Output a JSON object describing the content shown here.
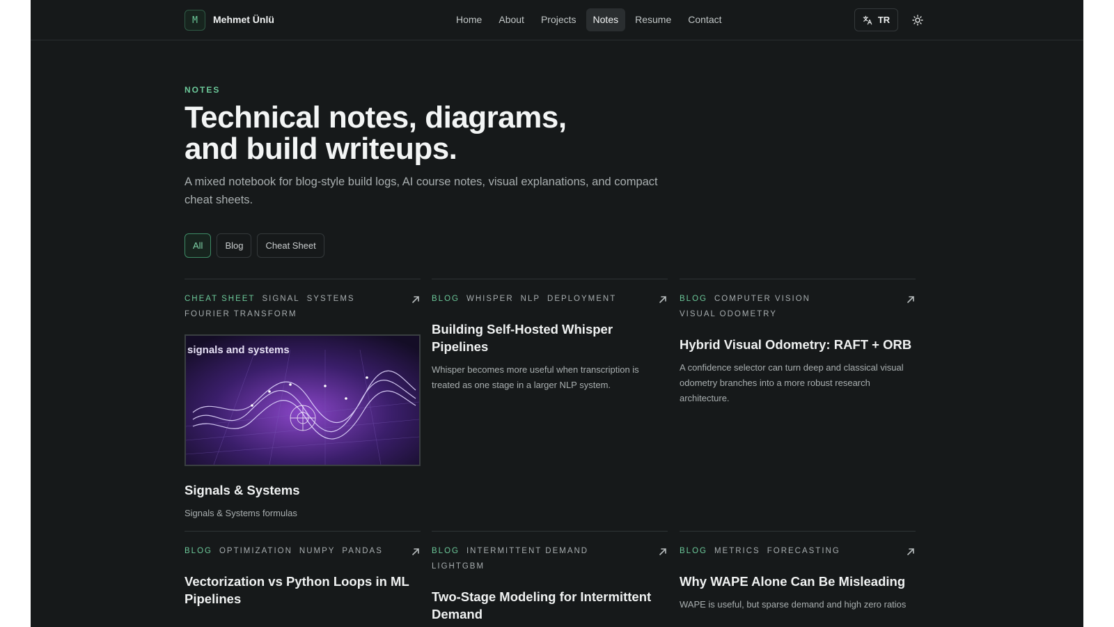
{
  "brand": {
    "logo_letter": "M",
    "name": "Mehmet Ünlü"
  },
  "nav": [
    "Home",
    "About",
    "Projects",
    "Notes",
    "Resume",
    "Contact"
  ],
  "nav_active": "Notes",
  "lang_label": "TR",
  "hero": {
    "eyebrow": "NOTES",
    "title_line1": "Technical notes, diagrams,",
    "title_line2": "and build writeups.",
    "subtitle": "A mixed notebook for blog-style build logs, AI course notes, visual explanations, and compact cheat sheets."
  },
  "filters": [
    "All",
    "Blog",
    "Cheat Sheet"
  ],
  "filter_active": "All",
  "cards": [
    {
      "tags": [
        "CHEAT SHEET",
        "SIGNAL",
        "SYSTEMS",
        "FOURIER TRANSFORM"
      ],
      "image_caption": "signals and systems",
      "title": "Signals & Systems",
      "desc": "Signals & Systems formulas"
    },
    {
      "tags": [
        "BLOG",
        "WHISPER",
        "NLP",
        "DEPLOYMENT"
      ],
      "title": "Building Self-Hosted Whisper Pipelines",
      "desc": "Whisper becomes more useful when transcription is treated as one stage in a larger NLP system."
    },
    {
      "tags": [
        "BLOG",
        "COMPUTER VISION",
        "VISUAL ODOMETRY"
      ],
      "title": "Hybrid Visual Odometry: RAFT + ORB",
      "desc": "A confidence selector can turn deep and classical visual odometry branches into a more robust research architecture."
    },
    {
      "tags": [
        "BLOG",
        "OPTIMIZATION",
        "NUMPY",
        "PANDAS"
      ],
      "title": "Vectorization vs Python Loops in ML Pipelines",
      "desc": ""
    },
    {
      "tags": [
        "BLOG",
        "INTERMITTENT DEMAND",
        "LIGHTGBM"
      ],
      "title": "Two-Stage Modeling for Intermittent Demand",
      "desc": ""
    },
    {
      "tags": [
        "BLOG",
        "METRICS",
        "FORECASTING"
      ],
      "title": "Why WAPE Alone Can Be Misleading",
      "desc": "WAPE is useful, but sparse demand and high zero ratios"
    }
  ],
  "colors": {
    "background": "#16191a",
    "accent": "#6cc99a",
    "text": "#f0f2f2",
    "muted": "#a9afb0"
  }
}
